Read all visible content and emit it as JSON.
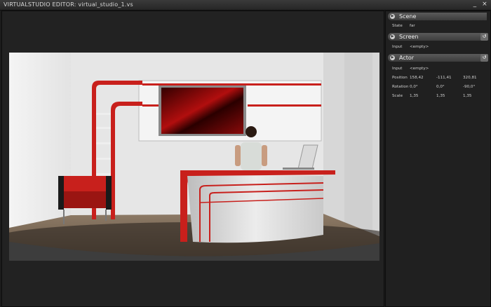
{
  "app": {
    "title": "VIRTUALSTUDIO EDITOR: virtual_studio_1.vs",
    "minimize": "_",
    "close": "×"
  },
  "scene": {
    "title": "Scene",
    "state_label": "State",
    "state_value": "far"
  },
  "screen": {
    "title": "Screen",
    "input_label": "Input",
    "input_value": "<empty>"
  },
  "actor": {
    "title": "Actor",
    "input_label": "Input",
    "input_value": "<empty>",
    "position_label": "Position",
    "position": [
      "158,42",
      "-111,41",
      "320,81"
    ],
    "rotation_label": "Rotation",
    "rotation": [
      "0,0°",
      "0,0°",
      "-90,0°"
    ],
    "scale_label": "Scale",
    "scale": [
      "1,35",
      "1,35",
      "1,35"
    ]
  },
  "icons": {
    "panel_toggle": "circle-arrow-icon",
    "reset": "reset-icon"
  },
  "colors": {
    "accent_red": "#c8201c",
    "background": "#1b1b1b",
    "panel": "#202020"
  }
}
